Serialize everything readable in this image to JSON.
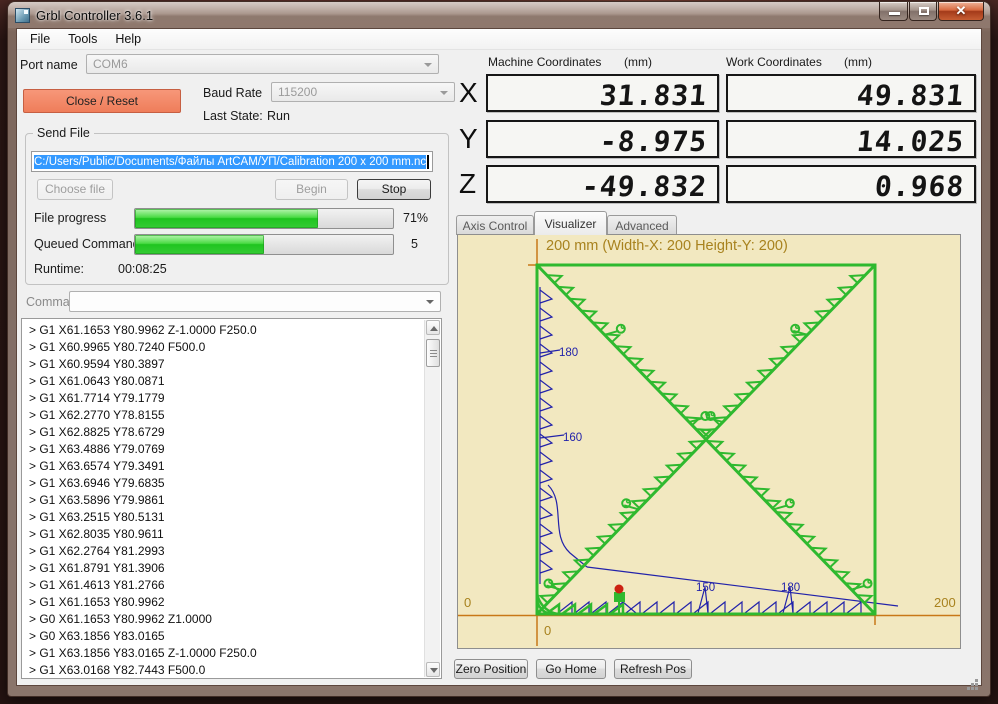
{
  "window": {
    "title": "Grbl Controller 3.6.1"
  },
  "menu": {
    "items": [
      "File",
      "Tools",
      "Help"
    ]
  },
  "connection": {
    "port_label": "Port name",
    "port_value": "COM6",
    "close_reset_label": "Close / Reset",
    "baud_label": "Baud Rate",
    "baud_value": "115200",
    "last_state_label": "Last State:",
    "last_state_value": "Run"
  },
  "send_file": {
    "group_label": "Send File",
    "file_path": "C:/Users/Public/Documents/Файлы ArtCAM/УП/Calibration 200 x 200 mm.nc",
    "choose_file_label": "Choose file",
    "begin_label": "Begin",
    "stop_label": "Stop",
    "file_progress_label": "File progress",
    "file_progress_percent": "71%",
    "file_progress_value": 71,
    "queued_label": "Queued Commands",
    "queued_value": "5",
    "queued_fill_percent": 50,
    "runtime_label": "Runtime:",
    "runtime_value": "00:08:25"
  },
  "command": {
    "label": "Command",
    "value": ""
  },
  "log": {
    "lines": [
      "> G1 X61.1653 Y80.9962 Z-1.0000 F250.0",
      "> G1 X60.9965 Y80.7240  F500.0",
      "> G1 X60.9594 Y80.3897",
      "> G1 X61.0643 Y80.0871",
      "> G1 X61.7714 Y79.1779",
      "> G1 X62.2770 Y78.8155",
      "> G1 X62.8825 Y78.6729",
      "> G1 X63.4886 Y79.0769",
      "> G1 X63.6574 Y79.3491",
      "> G1 X63.6946 Y79.6835",
      "> G1 X63.5896 Y79.9861",
      "> G1 X63.2515 Y80.5131",
      "> G1 X62.8035 Y80.9611",
      "> G1 X62.2764 Y81.2993",
      "> G1 X61.8791 Y81.3906",
      "> G1 X61.4613 Y81.2766",
      "> G1 X61.1653 Y80.9962",
      "> G0 X61.1653 Y80.9962 Z1.0000",
      "> G0 X63.1856 Y83.0165",
      "> G1 X63.1856 Y83.0165 Z-1.0000 F250.0",
      "> G1 X63.0168 Y82.7443  F500.0"
    ]
  },
  "coordinates": {
    "machine_label": "Machine Coordinates",
    "work_label": "Work Coordinates",
    "units": "(mm)",
    "axes": [
      {
        "axis": "X",
        "machine": "31.831",
        "work": "49.831"
      },
      {
        "axis": "Y",
        "machine": "-8.975",
        "work": "14.025"
      },
      {
        "axis": "Z",
        "machine": "-49.832",
        "work": "0.968"
      }
    ]
  },
  "tabs": {
    "items": [
      "Axis Control",
      "Visualizer",
      "Advanced"
    ],
    "active": "Visualizer"
  },
  "visualizer": {
    "header": "200 mm  (Width-X: 200  Height-Y: 200)",
    "x_min_label": "0",
    "x_max_label": "200",
    "origin_label": "0",
    "annotations": [
      "180",
      "160",
      "150",
      "180"
    ],
    "colors": {
      "background": "#f2e8c0",
      "toolpath_done": "#2fb92f",
      "toolpath_pending": "#2222aa",
      "axis": "#c87818",
      "label": "#a8821e",
      "marker": "#cc2211"
    }
  },
  "position_buttons": {
    "zero": "Zero Position",
    "home": "Go Home",
    "refresh": "Refresh Pos"
  },
  "ui_colors": {
    "close_reset_button": "#f28563",
    "progress_fill": "#35cc35",
    "selection": "#3399ff"
  }
}
